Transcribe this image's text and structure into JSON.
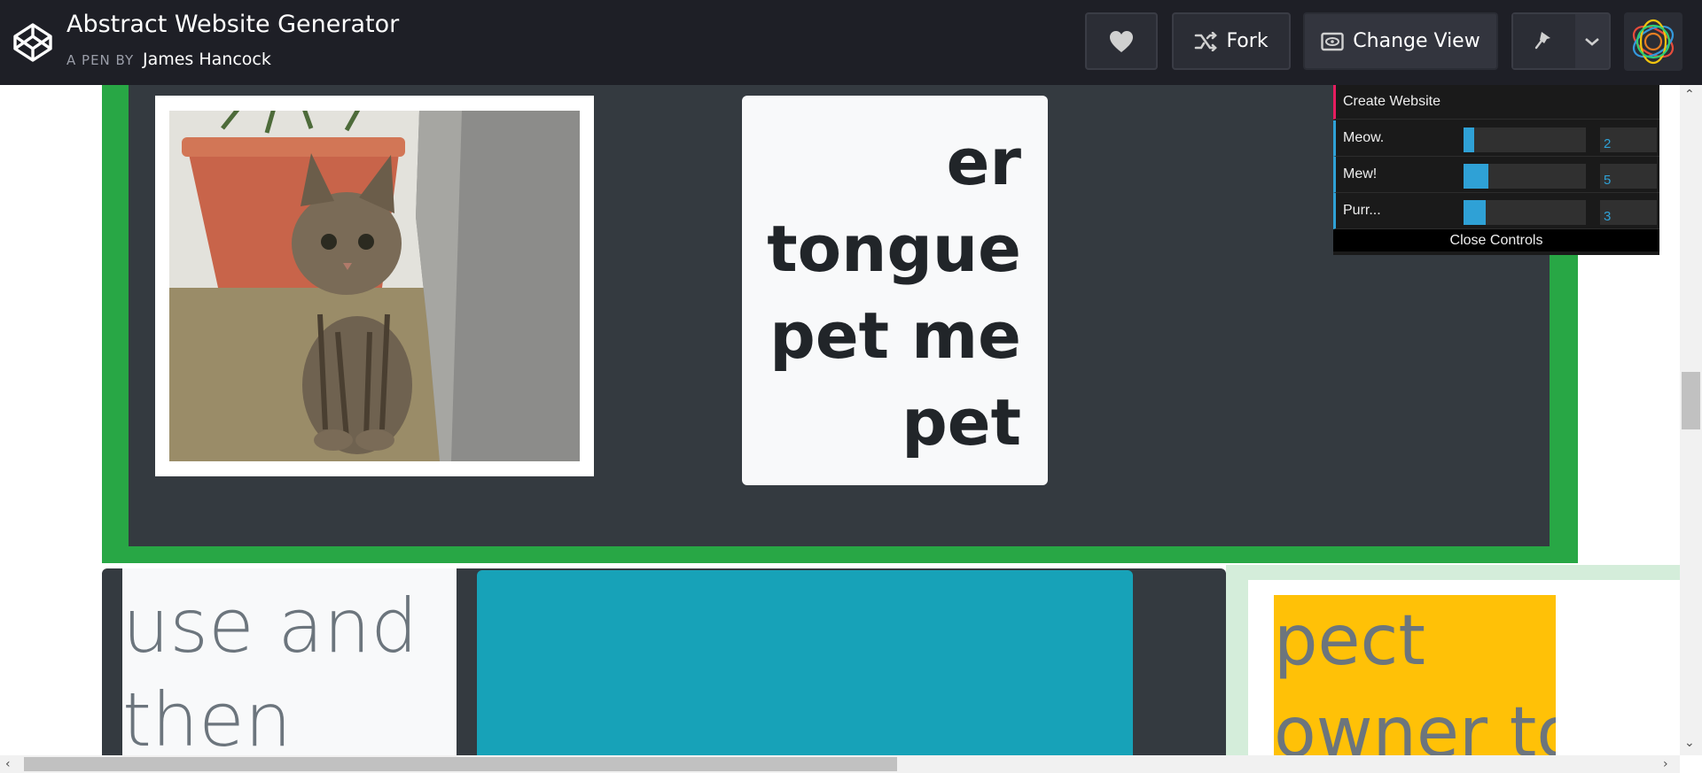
{
  "header": {
    "title": "Abstract Website Generator",
    "by_label": "A PEN BY",
    "author": "James Hancock",
    "fork_label": "Fork",
    "change_view_label": "Change View",
    "icons": [
      "codepen-logo-icon",
      "heart-icon",
      "fork-icon",
      "eye-icon",
      "pin-icon",
      "chevron-down-icon"
    ]
  },
  "content": {
    "text_card_lines": [
      "er",
      "tongue",
      "pet me",
      "pet"
    ],
    "light_card_lines": [
      "use and",
      "then"
    ],
    "yellow_card_lines": [
      "pect",
      "owner to"
    ],
    "colors": {
      "green": "#28a745",
      "dark": "#343a40",
      "teal": "#17a2b8",
      "yellow": "#ffc107",
      "mint": "#d4edda"
    }
  },
  "controls": {
    "create_label": "Create Website",
    "sliders": [
      {
        "label": "Meow.",
        "value": "2",
        "fill_fraction": 0.09
      },
      {
        "label": "Mew!",
        "value": "5",
        "fill_fraction": 0.2
      },
      {
        "label": "Purr...",
        "value": "3",
        "fill_fraction": 0.18
      }
    ],
    "close_label": "Close Controls",
    "accent": "#2fa1d6"
  }
}
